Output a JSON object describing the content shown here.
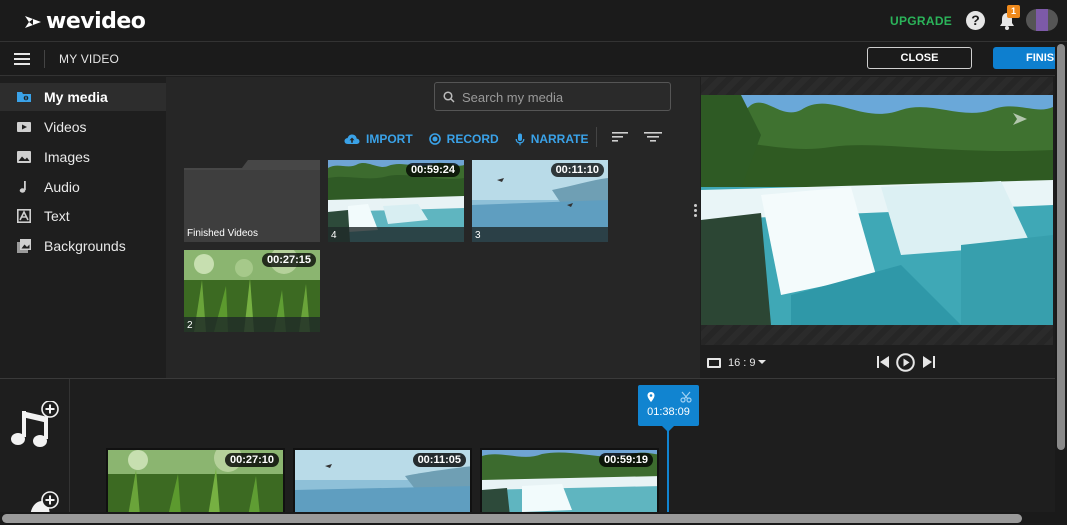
{
  "app": {
    "logo_text": "wevideo",
    "upgrade_label": "UPGRADE",
    "help_label": "?",
    "notification_count": "1",
    "accent": "#1184d0",
    "upgrade_color": "#2bb45a"
  },
  "subbar": {
    "project_title": "MY VIDEO",
    "close_label": "CLOSE",
    "finish_label": "FINISH"
  },
  "sidebar": {
    "items": [
      {
        "label": "My media",
        "icon": "folder-icon",
        "active": true
      },
      {
        "label": "Videos",
        "icon": "video-icon"
      },
      {
        "label": "Images",
        "icon": "image-icon"
      },
      {
        "label": "Audio",
        "icon": "music-note-icon"
      },
      {
        "label": "Text",
        "icon": "text-icon"
      },
      {
        "label": "Backgrounds",
        "icon": "backgrounds-icon"
      }
    ]
  },
  "media": {
    "search_placeholder": "Search my media",
    "actions": {
      "import": "IMPORT",
      "record": "RECORD",
      "narrate": "NARRATE"
    },
    "folder": {
      "label": "Finished Videos"
    },
    "items": [
      {
        "duration": "00:59:24",
        "number": "4"
      },
      {
        "duration": "00:11:10",
        "number": "3"
      },
      {
        "duration": "00:27:15",
        "number": "2"
      }
    ]
  },
  "preview": {
    "aspect_ratio": "16 : 9"
  },
  "timeline": {
    "playhead_time": "01:38:09",
    "clips": [
      {
        "duration": "00:27:10"
      },
      {
        "duration": "00:11:05"
      },
      {
        "duration": "00:59:19"
      }
    ]
  }
}
